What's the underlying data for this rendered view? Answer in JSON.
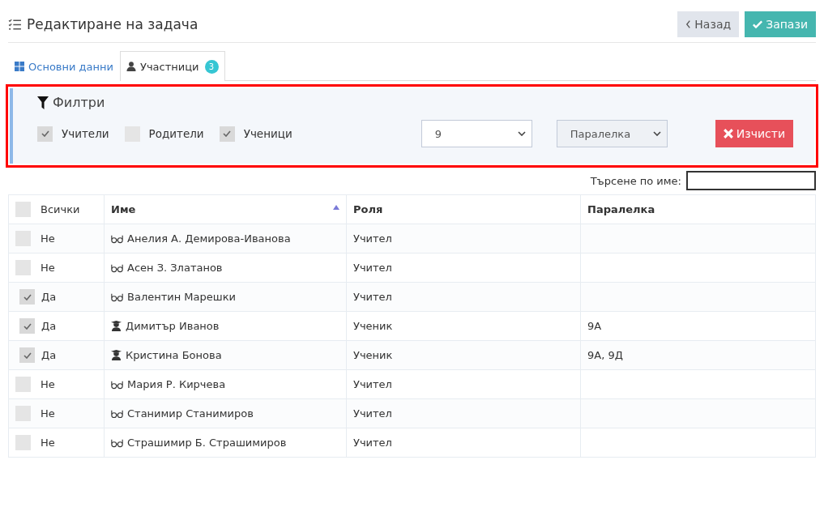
{
  "header": {
    "title": "Редактиране на задача",
    "buttons": [
      {
        "kind": "back",
        "label": "Назад"
      },
      {
        "kind": "save",
        "label": "Запази"
      }
    ]
  },
  "tabs": [
    {
      "label": "Основни данни",
      "selected": false
    },
    {
      "label": "Участници",
      "badge": "3",
      "selected": true
    }
  ],
  "filters": {
    "title": "Филтри",
    "highlighted": true,
    "checkboxes": [
      {
        "label": "Учители",
        "checked": true
      },
      {
        "label": "Родители",
        "checked": false
      },
      {
        "label": "Ученици",
        "checked": true
      }
    ],
    "selects": [
      {
        "value": "9",
        "disabled": false
      },
      {
        "value": "Паралелка",
        "disabled": true
      }
    ],
    "clear_button": "Изчисти"
  },
  "search": {
    "label": "Търсене по име:"
  },
  "table": {
    "columns": [
      {
        "label": "Всички",
        "checked": false,
        "sorted": false
      },
      {
        "label": "Име",
        "sorted": true
      },
      {
        "label": "Роля",
        "sorted": false
      },
      {
        "label": "Паралелка",
        "sorted": false
      }
    ],
    "rows": [
      {
        "checked": false,
        "included": "Не",
        "kind": "teacher",
        "name": "Анелия А. Демирова-Иванова",
        "role": "Учител"
      },
      {
        "checked": false,
        "included": "Не",
        "kind": "teacher",
        "name": "Асен З. Златанов",
        "role": "Учител"
      },
      {
        "checked": true,
        "included": "Да",
        "kind": "teacher",
        "name": "Валентин Марешки",
        "role": "Учител"
      },
      {
        "checked": true,
        "included": "Да",
        "kind": "student",
        "name": "Димитър Иванов",
        "role": "Ученик",
        "class": "9А"
      },
      {
        "checked": true,
        "included": "Да",
        "kind": "student",
        "name": "Кристина Бонова",
        "role": "Ученик",
        "class": "9А, 9Д"
      },
      {
        "checked": false,
        "included": "Не",
        "kind": "teacher",
        "name": "Мария Р. Кирчева",
        "role": "Учител"
      },
      {
        "checked": false,
        "included": "Не",
        "kind": "teacher",
        "name": "Станимир Станимиров",
        "role": "Учител"
      },
      {
        "checked": false,
        "included": "Не",
        "kind": "teacher",
        "name": "Страшимир Б. Страшимиров",
        "role": "Учител"
      }
    ]
  }
}
